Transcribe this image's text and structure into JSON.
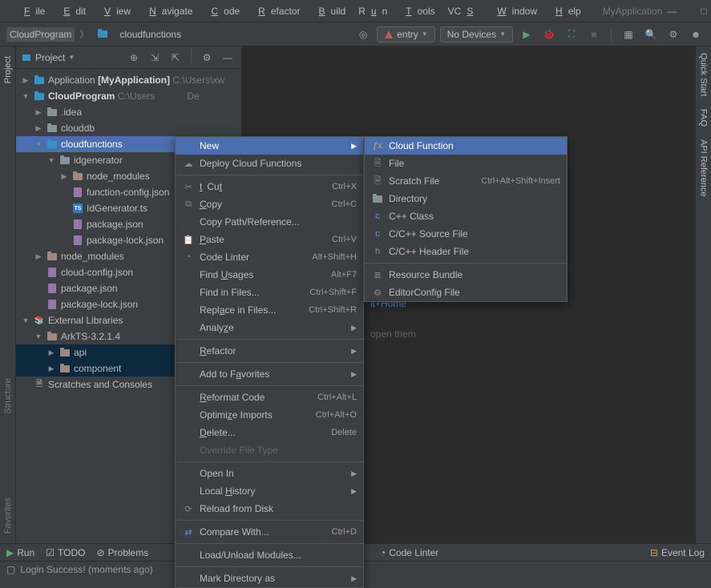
{
  "app_name": "MyApplication",
  "menu": [
    "File",
    "Edit",
    "View",
    "Navigate",
    "Code",
    "Refactor",
    "Build",
    "Run",
    "Tools",
    "VCS",
    "Window",
    "Help"
  ],
  "breadcrumb": {
    "root": "CloudProgram",
    "leaf": "cloudfunctions"
  },
  "toolbar": {
    "config": "entry",
    "device": "No Devices"
  },
  "panel": {
    "title": "Project"
  },
  "tree": {
    "app_root": "Application",
    "app_proj": "[MyApplication]",
    "app_path": "C:\\Users\\xw",
    "cloud_root": "CloudProgram",
    "cloud_path": "C:\\Users",
    "cloud_path_suffix": "De",
    "idea": ".idea",
    "clouddb": "clouddb",
    "cloudfunctions": "cloudfunctions",
    "idgenerator": "idgenerator",
    "node_modules": "node_modules",
    "function_config": "function-config.json",
    "idgen_ts": "IdGenerator.ts",
    "package_json": "package.json",
    "package_lock": "package-lock.json",
    "cloud_config": "cloud-config.json",
    "ext_lib": "External Libraries",
    "arkts": "ArkTS-3.2.1.4",
    "api": "api",
    "component": "component",
    "scratches": "Scratches and Consoles"
  },
  "context_menu": {
    "new": "New",
    "deploy": "Deploy Cloud Functions",
    "cut": "Cut",
    "cut_sc": "Ctrl+X",
    "copy": "Copy",
    "copy_sc": "Ctrl+C",
    "copy_path": "Copy Path/Reference...",
    "paste": "Paste",
    "paste_sc": "Ctrl+V",
    "code_linter": "Code Linter",
    "code_linter_sc": "Alt+Shift+H",
    "find_usages": "Find Usages",
    "find_usages_sc": "Alt+F7",
    "find_in_files": "Find in Files...",
    "fif_sc": "Ctrl+Shift+F",
    "replace_in_files": "Replace in Files...",
    "rif_sc": "Ctrl+Shift+R",
    "analyze": "Analyze",
    "refactor": "Refactor",
    "add_fav": "Add to Favorites",
    "reformat": "Reformat Code",
    "reformat_sc": "Ctrl+Alt+L",
    "optimize": "Optimize Imports",
    "optimize_sc": "Ctrl+Alt+O",
    "delete": "Delete...",
    "delete_sc": "Delete",
    "override": "Override File Type",
    "open_in": "Open In",
    "local_history": "Local History",
    "reload": "Reload from Disk",
    "compare": "Compare With...",
    "compare_sc": "Ctrl+D",
    "load_modules": "Load/Unload Modules...",
    "mark_dir": "Mark Directory as"
  },
  "submenu": {
    "cloud_function": "Cloud Function",
    "file": "File",
    "scratch": "Scratch File",
    "scratch_sc": "Ctrl+Alt+Shift+Insert",
    "directory": "Directory",
    "cpp_class": "C++ Class",
    "c_source": "C/C++ Source File",
    "c_header": "C/C++ Header File",
    "resource_bundle": "Resource Bundle",
    "editor_config": "EditorConfig File"
  },
  "editor_hints": {
    "shortcut": "lt+Home",
    "tail": "open them"
  },
  "right_tabs": [
    "Quick Start",
    "FAQ",
    "API Reference"
  ],
  "left_tabs": {
    "project": "Project",
    "structure": "Structure",
    "favorites": "Favorites"
  },
  "bottom": {
    "run": "Run",
    "todo": "TODO",
    "problems": "Problems",
    "code_linter": "Code Linter",
    "event_log": "Event Log"
  },
  "status": "Login Success! (moments ago)"
}
